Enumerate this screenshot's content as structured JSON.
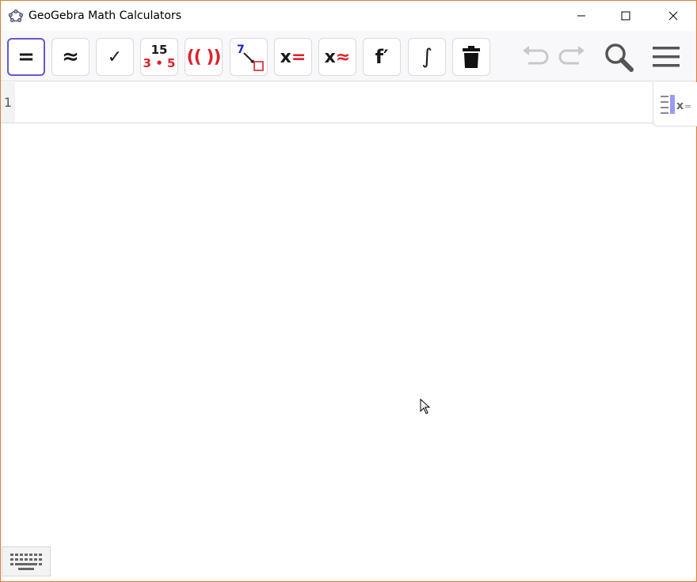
{
  "window": {
    "title": "GeoGebra Math Calculators",
    "app_icon": "geogebra-logo-icon",
    "controls": [
      "minimize-icon",
      "maximize-icon",
      "close-icon"
    ]
  },
  "toolbar": {
    "tools": [
      {
        "name": "evaluate",
        "icon": "equals-icon",
        "glyph": "=",
        "selected": true
      },
      {
        "name": "numeric",
        "icon": "approx-icon",
        "glyph": "≈",
        "selected": false
      },
      {
        "name": "keep-input",
        "icon": "check-icon",
        "glyph": "✓",
        "selected": false
      },
      {
        "name": "factor-number",
        "icon": "factor-icon",
        "top": "15",
        "bottom": "3 • 5",
        "selected": false
      },
      {
        "name": "expand",
        "icon": "parentheses-icon",
        "glyph": "(( ))",
        "selected": false
      },
      {
        "name": "substitute",
        "icon": "substitute-icon",
        "top": "7",
        "selected": false
      },
      {
        "name": "solve",
        "icon": "solve-icon",
        "x": "x",
        "op": "=",
        "selected": false
      },
      {
        "name": "solve-numerically",
        "icon": "solve-numeric-icon",
        "x": "x",
        "op": "≈",
        "selected": false
      },
      {
        "name": "derivative",
        "icon": "derivative-icon",
        "glyph": "f′",
        "selected": false
      },
      {
        "name": "integral",
        "icon": "integral-icon",
        "glyph": "∫",
        "selected": false
      },
      {
        "name": "delete",
        "icon": "trash-icon",
        "selected": false
      }
    ],
    "right": [
      "undo-icon",
      "redo-icon",
      "search-icon",
      "menu-icon"
    ]
  },
  "algebra": {
    "row_number": "1",
    "input_value": "",
    "view_toggle_icon": "algebra-view-icon"
  },
  "keyboard": {
    "icon": "keyboard-icon"
  },
  "colors": {
    "accent": "#6557d2",
    "red": "#e0202a",
    "blue": "#1d1dc7",
    "border": "#e07b39"
  }
}
